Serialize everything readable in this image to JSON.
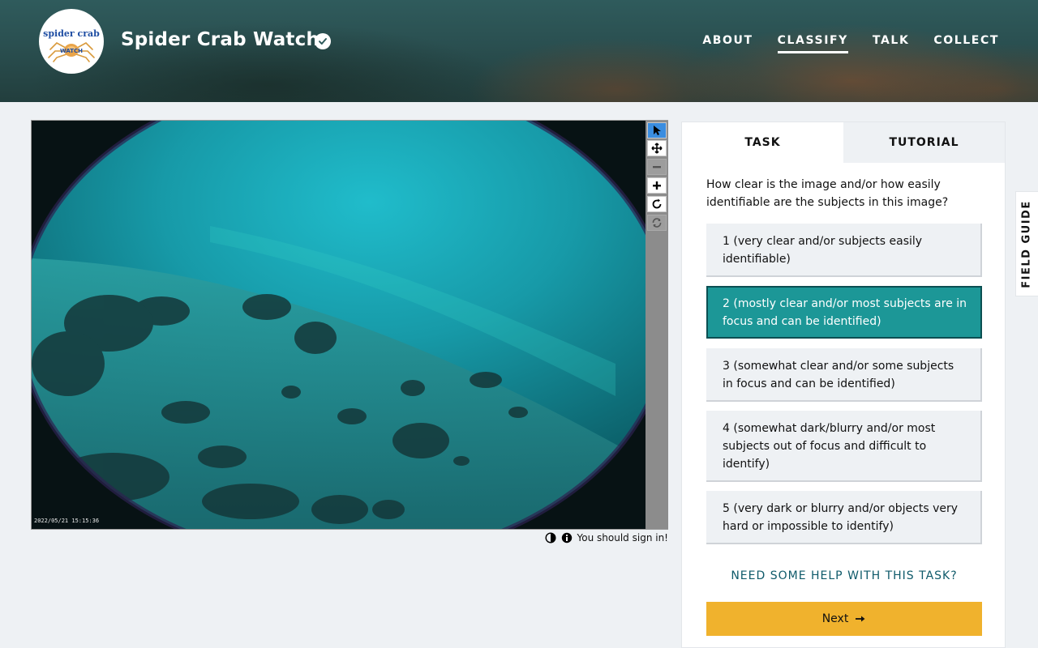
{
  "header": {
    "logo": {
      "line1": "spider crab",
      "line2": "WATCH"
    },
    "title": "Spider Crab Watch",
    "nav": [
      {
        "label": "ABOUT",
        "active": false
      },
      {
        "label": "CLASSIFY",
        "active": true
      },
      {
        "label": "TALK",
        "active": false
      },
      {
        "label": "COLLECT",
        "active": false
      }
    ]
  },
  "viewer": {
    "timestamp": "2022/05/21 15:15:36",
    "tools": [
      "pointer-icon",
      "move-icon",
      "zoom-out-icon",
      "zoom-in-icon",
      "rotate-icon",
      "reset-icon"
    ],
    "active_tool": "pointer-icon",
    "sign_in_text": "You should sign in!"
  },
  "panel": {
    "tabs": [
      {
        "label": "TASK",
        "active": true
      },
      {
        "label": "TUTORIAL",
        "active": false
      }
    ],
    "question": "How clear is the image and/or how easily identifiable are the subjects in this image?",
    "answers": [
      {
        "label": "1 (very clear and/or subjects easily identifiable)",
        "selected": false
      },
      {
        "label": "2 (mostly clear and/or most subjects are in focus and can be identified)",
        "selected": true
      },
      {
        "label": "3 (somewhat clear and/or some subjects in focus and can be identified)",
        "selected": false
      },
      {
        "label": "4 (somewhat dark/blurry and/or most subjects out of focus and difficult to identify)",
        "selected": false
      },
      {
        "label": "5 (very dark or blurry and/or objects very hard or impossible to identify)",
        "selected": false
      }
    ],
    "help_link": "NEED SOME HELP WITH THIS TASK?",
    "next_label": "Next"
  },
  "field_guide_label": "FIELD GUIDE",
  "colors": {
    "selected_answer": "#1c9797",
    "next_button": "#f0b22d",
    "help_link": "#0f5a6a",
    "active_tool": "#3a8de0"
  }
}
